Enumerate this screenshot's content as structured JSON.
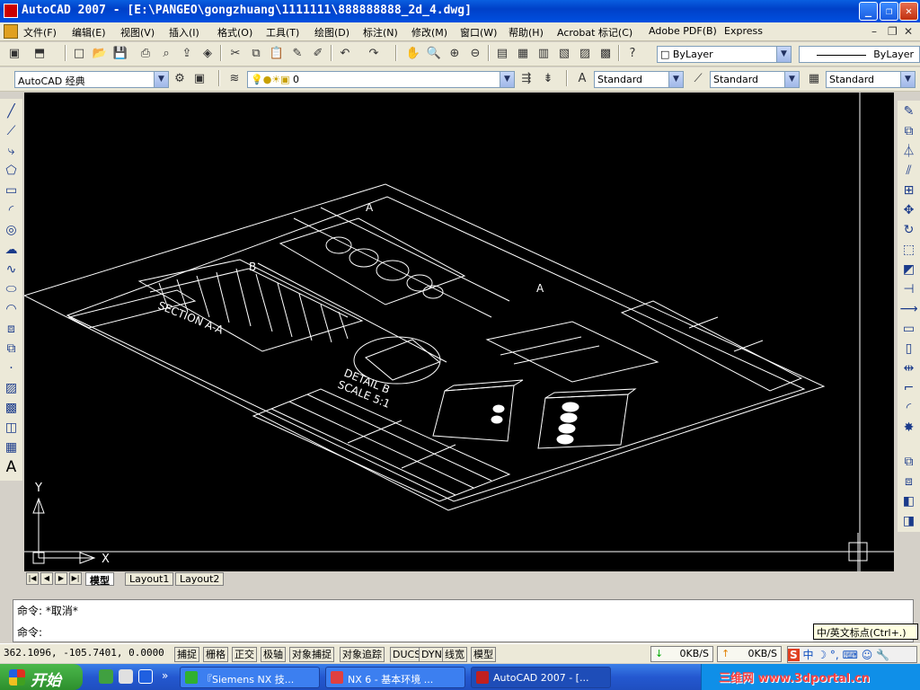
{
  "window": {
    "title": "AutoCAD 2007 - [E:\\PANGEO\\gongzhuang\\1111111\\888888888_2d_4.dwg]"
  },
  "menu": [
    "文件(F)",
    "编辑(E)",
    "视图(V)",
    "插入(I)",
    "格式(O)",
    "工具(T)",
    "绘图(D)",
    "标注(N)",
    "修改(M)",
    "窗口(W)",
    "帮助(H)",
    "Acrobat 标记(C)",
    "Adobe PDF(B)",
    "Express"
  ],
  "toolbar": {
    "workspace": "AutoCAD 经典",
    "layer": "0",
    "color": "ByLayer",
    "linetype": "ByLayer",
    "text_style": "Standard",
    "dim_style": "Standard",
    "table_style": "Standard"
  },
  "drawing": {
    "labels": {
      "section": "SECTION A-A",
      "detail": "DETAIL B",
      "scale": "SCALE 5:1",
      "a_top": "A",
      "a_right": "A",
      "b": "B"
    }
  },
  "tabs": [
    "模型",
    "Layout1",
    "Layout2"
  ],
  "command": {
    "line1": "命令: *取消*",
    "line2": "命令:"
  },
  "ime_hint": "中/英文标点(Ctrl+.)",
  "status": {
    "coords": "362.1096, -105.7401, 0.0000",
    "toggles": [
      "捕捉",
      "栅格",
      "正交",
      "极轴",
      "对象捕捉",
      "对象追踪",
      "DUCS",
      "DYN",
      "线宽",
      "模型"
    ],
    "down": "0KB/S",
    "up": "0KB/S"
  },
  "taskbar": {
    "start": "开始",
    "tasks": [
      "『Siemens NX 技...",
      "NX 6 - 基本环境 ...",
      "AutoCAD 2007 - [..."
    ],
    "watermark": "三维网 www.3dportal.cn"
  }
}
